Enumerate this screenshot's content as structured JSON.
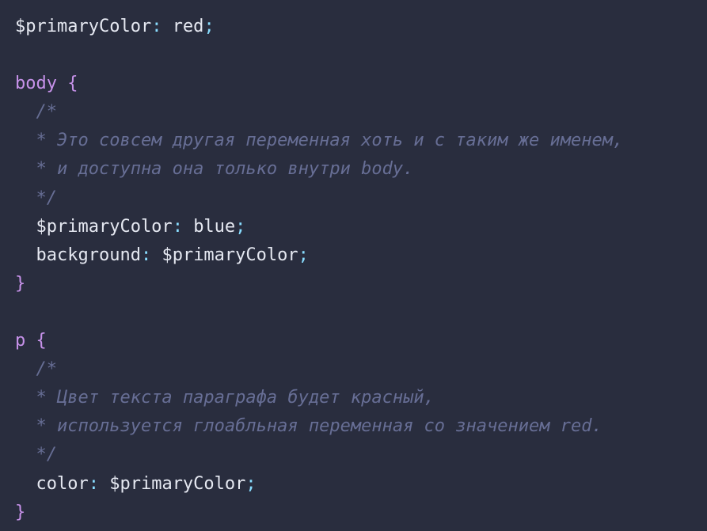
{
  "colors": {
    "background": "#292d3e",
    "text": "#e5e8f1",
    "punctuation": "#89ddff",
    "brace": "#c792ea",
    "selector": "#c792ea",
    "comment": "#676e95"
  },
  "code_lines": [
    [
      {
        "t": "$primaryColor",
        "c": "text"
      },
      {
        "t": ": ",
        "c": "punct"
      },
      {
        "t": "red",
        "c": "text"
      },
      {
        "t": ";",
        "c": "punct"
      }
    ],
    [],
    [
      {
        "t": "body",
        "c": "selector"
      },
      {
        "t": " ",
        "c": "text"
      },
      {
        "t": "{",
        "c": "brace"
      }
    ],
    [
      {
        "t": "  /*",
        "c": "comment"
      }
    ],
    [
      {
        "t": "  * Это совсем другая переменная хоть и с таким же именем,",
        "c": "comment"
      }
    ],
    [
      {
        "t": "  * и доступна она только внутри body.",
        "c": "comment"
      }
    ],
    [
      {
        "t": "  */",
        "c": "comment"
      }
    ],
    [
      {
        "t": "  $primaryColor",
        "c": "text"
      },
      {
        "t": ": ",
        "c": "punct"
      },
      {
        "t": "blue",
        "c": "text"
      },
      {
        "t": ";",
        "c": "punct"
      }
    ],
    [
      {
        "t": "  background",
        "c": "text"
      },
      {
        "t": ": ",
        "c": "punct"
      },
      {
        "t": "$primaryColor",
        "c": "text"
      },
      {
        "t": ";",
        "c": "punct"
      }
    ],
    [
      {
        "t": "}",
        "c": "brace"
      }
    ],
    [],
    [
      {
        "t": "p",
        "c": "selector"
      },
      {
        "t": " ",
        "c": "text"
      },
      {
        "t": "{",
        "c": "brace"
      }
    ],
    [
      {
        "t": "  /*",
        "c": "comment"
      }
    ],
    [
      {
        "t": "  * Цвет текста параграфа будет красный,",
        "c": "comment"
      }
    ],
    [
      {
        "t": "  * используется глоабльная переменная со значением red.",
        "c": "comment"
      }
    ],
    [
      {
        "t": "  */",
        "c": "comment"
      }
    ],
    [
      {
        "t": "  color",
        "c": "text"
      },
      {
        "t": ": ",
        "c": "punct"
      },
      {
        "t": "$primaryColor",
        "c": "text"
      },
      {
        "t": ";",
        "c": "punct"
      }
    ],
    [
      {
        "t": "}",
        "c": "brace"
      }
    ]
  ]
}
